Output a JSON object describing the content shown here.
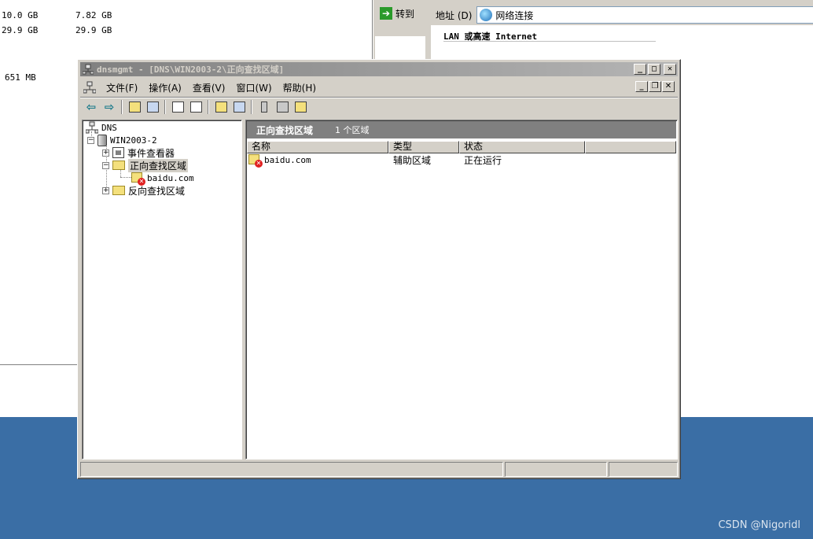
{
  "background": {
    "disk_rows": [
      {
        "col1": "10.0 GB",
        "col2": "7.82 GB"
      },
      {
        "col1": "29.9 GB",
        "col2": "29.9 GB"
      }
    ],
    "memory_value": "651 MB",
    "goto_label": "转到",
    "address_label": "地址 (D)",
    "address_value": "网络连接",
    "lan_heading": "LAN 或高速 Internet"
  },
  "window": {
    "title": "dnsmgmt - [DNS\\WIN2003-2\\正向查找区域]",
    "menu": [
      "文件(F)",
      "操作(A)",
      "查看(V)",
      "窗口(W)",
      "帮助(H)"
    ]
  },
  "tree": {
    "root": "DNS",
    "server": "WIN2003-2",
    "event_viewer": "事件查看器",
    "forward_zones": "正向查找区域",
    "zone_item": "baidu.com",
    "reverse_zones": "反向查找区域"
  },
  "details": {
    "header_title": "正向查找区域",
    "header_count": "1 个区域",
    "columns": [
      "名称",
      "类型",
      "状态"
    ],
    "rows": [
      {
        "name": "baidu.com",
        "type": "辅助区域",
        "status": "正在运行"
      }
    ]
  },
  "watermark": "CSDN @Nigoridl"
}
